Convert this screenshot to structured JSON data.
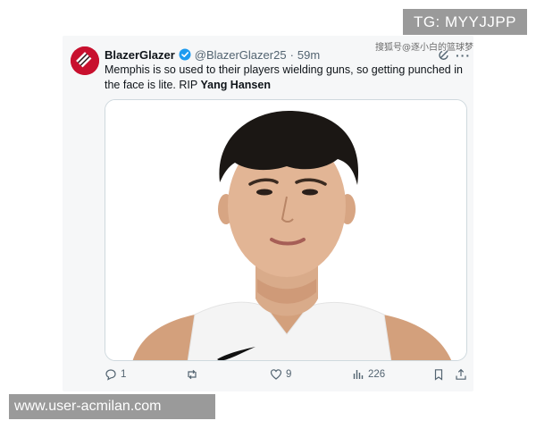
{
  "tweet": {
    "display_name": "BlazerGlazer",
    "handle": "@BlazerGlazer25",
    "separator": "·",
    "time": "59m",
    "text_before": "Memphis is so used to their players wielding guns, so getting punched in the face is lite. RIP ",
    "text_mention": "Yang Hansen",
    "more": "···",
    "avatar_color": "#c8102e",
    "verified_color": "#1d9bf0"
  },
  "watermark_caption": "搜狐号@逐小白的篮球梦",
  "actions": {
    "reply_count": "1",
    "repost_count": "",
    "like_count": "9",
    "views_count": "226"
  },
  "overlays": {
    "tg_badge": "TG: MYYJJPP",
    "url_badge": "www.user-acmilan.com"
  }
}
